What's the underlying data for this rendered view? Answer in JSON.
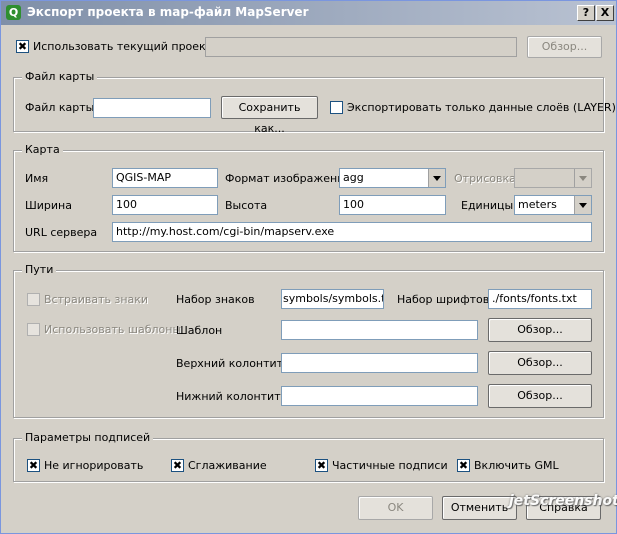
{
  "window": {
    "title": "Экспорт проекта в map-файл MapServer",
    "help_btn": "?",
    "close_btn": "X"
  },
  "top": {
    "use_project_label": "Использовать текущий проект",
    "use_project_checked": true,
    "project_path": "",
    "browse_label": "Обзор..."
  },
  "mapfile": {
    "legend": "Файл карты",
    "label": "Файл карты",
    "value": "",
    "save_as_label": "Сохранить как...",
    "layers_only_label": "Экспортировать только данные слоёв (LAYER)",
    "layers_only_checked": false
  },
  "map": {
    "legend": "Карта",
    "name_label": "Имя",
    "name_value": "QGIS-MAP",
    "format_label": "Формат изображения",
    "format_value": "agg",
    "render_label": "Отрисовка",
    "render_value": "",
    "width_label": "Ширина",
    "width_value": "100",
    "height_label": "Высота",
    "height_value": "100",
    "units_label": "Единицы",
    "units_value": "meters",
    "url_label": "URL сервера",
    "url_value": "http://my.host.com/cgi-bin/mapserv.exe"
  },
  "paths": {
    "legend": "Пути",
    "embed_symbols_label": "Встраивать знаки",
    "use_templates_label": "Использовать шаблоны",
    "symbolset_label": "Набор знаков",
    "symbolset_value": "symbols/symbols.txt",
    "fontset_label": "Набор шрифтов",
    "fontset_value": "./fonts/fonts.txt",
    "template_label": "Шаблон",
    "template_value": "",
    "header_label": "Верхний колонтиту",
    "header_value": "",
    "footer_label": "Нижний колонтиту",
    "footer_value": "",
    "browse_label": "Обзор..."
  },
  "labels": {
    "legend": "Параметры подписей",
    "no_ignore_label": "Не игнорировать",
    "antialias_label": "Сглаживание",
    "partials_label": "Частичные подписи",
    "gml_label": "Включить GML"
  },
  "buttons": {
    "ok": "OK",
    "cancel": "Отменить",
    "help": "Справка"
  },
  "watermark": "jetScreenshot"
}
